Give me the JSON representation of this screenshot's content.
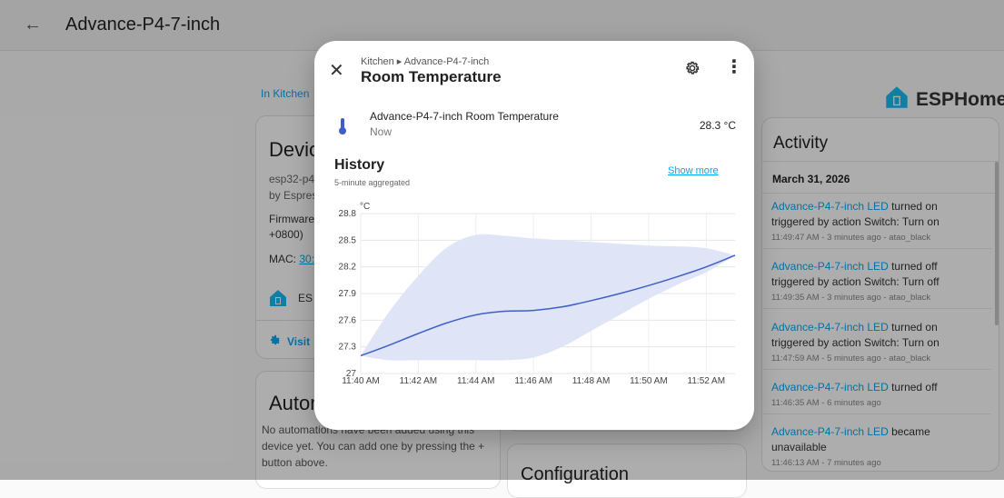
{
  "header": {
    "title": "Advance-P4-7-inch"
  },
  "breadcrumb": "In Kitchen",
  "device_card": {
    "title": "Device",
    "model": "esp32-p4-",
    "manufacturer": "by Espres",
    "firmware": "Firmware:",
    "firmware_2": "+0800)",
    "mac_label": "MAC:",
    "mac_value": "30:E",
    "esp_label": "ES",
    "visit_label": "Visit"
  },
  "automations_card": {
    "title": "Autom",
    "description": "No automations have been added using this device yet. You can add one by pressing the + button above."
  },
  "configuration_card": {
    "title": "Configuration"
  },
  "esphome_logo": "ESPHome",
  "activity": {
    "title": "Activity",
    "date": "March 31, 2026",
    "items": [
      {
        "entity": "Advance-P4-7-inch LED",
        "text": " turned on triggered by action Switch: Turn on",
        "meta": "11:49:47 AM - 3 minutes ago - atao_black"
      },
      {
        "entity": "Advance-P4-7-inch LED",
        "text": " turned off triggered by action Switch: Turn off",
        "meta": "11:49:35 AM - 3 minutes ago - atao_black"
      },
      {
        "entity": "Advance-P4-7-inch LED",
        "text": " turned on triggered by action Switch: Turn on",
        "meta": "11:47:59 AM - 5 minutes ago - atao_black"
      },
      {
        "entity": "Advance-P4-7-inch LED",
        "text": " turned off",
        "meta": "11:46:35 AM - 6 minutes ago"
      },
      {
        "entity": "Advance-P4-7-inch LED",
        "text": " became unavailable",
        "meta": "11:46:13 AM - 7 minutes ago"
      }
    ]
  },
  "dialog": {
    "breadcrumb": "Kitchen ▸ Advance-P4-7-inch",
    "title": "Room Temperature",
    "entity_name": "Advance-P4-7-inch Room Temperature",
    "entity_time": "Now",
    "entity_value": "28.3 °C",
    "history_title": "History",
    "history_subtitle": "5-minute aggregated",
    "show_more": "Show more"
  },
  "colors": {
    "accent": "#03a9f4",
    "line": "#3f5fc6",
    "band": "#dfe5f7"
  },
  "chart_data": {
    "type": "line",
    "ylabel": "°C",
    "ylim": [
      27,
      28.8
    ],
    "yticks": [
      "28.8",
      "28.5",
      "28.2",
      "27.9",
      "27.6",
      "27.3",
      "27"
    ],
    "xticks": [
      "11:40 AM",
      "11:42 AM",
      "11:44 AM",
      "11:46 AM",
      "11:48 AM",
      "11:50 AM",
      "11:52 AM"
    ],
    "x_minutes": [
      0,
      1,
      2,
      3,
      4,
      5,
      6,
      7,
      8,
      9,
      10,
      11,
      12,
      13
    ],
    "series": [
      {
        "values": [
          27.2,
          27.32,
          27.45,
          27.57,
          27.66,
          27.7,
          27.71,
          27.75,
          27.82,
          27.9,
          27.99,
          28.09,
          28.2,
          28.33
        ]
      }
    ],
    "band_min": [
      27.2,
      27.15,
      27.15,
      27.15,
      27.15,
      27.15,
      27.18,
      27.3,
      27.48,
      27.66,
      27.84,
      28.0,
      28.14,
      28.33
    ],
    "band_max": [
      27.2,
      27.7,
      28.1,
      28.42,
      28.56,
      28.55,
      28.52,
      28.5,
      28.48,
      28.46,
      28.44,
      28.43,
      28.41,
      28.33
    ]
  }
}
